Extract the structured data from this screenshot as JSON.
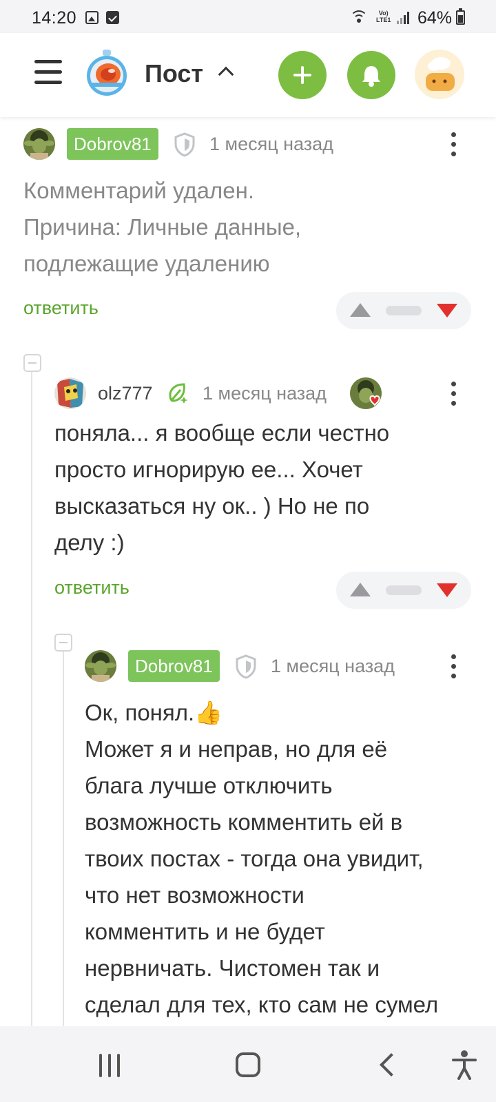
{
  "status_bar": {
    "time": "14:20",
    "network_label": "Vo)\nLTE1",
    "battery": "64%",
    "battery_level": 0.64,
    "icons": [
      "gallery-icon",
      "check-icon",
      "wifi-icon",
      "volte-icon",
      "signal-icon",
      "battery-icon"
    ]
  },
  "header": {
    "title": "Пост",
    "icons": [
      "menu-icon",
      "logo-icon",
      "chevron-up-icon",
      "plus-icon",
      "bell-icon",
      "avatar"
    ],
    "accent_color": "#7dbe42"
  },
  "comments": [
    {
      "author": "Dobrov81",
      "author_badge": true,
      "time": "1 месяц назад",
      "text_lines": [
        "Комментарий удален.",
        "Причина: Личные данные,",
        "подлежащие удалению"
      ],
      "deleted": true,
      "reply_label": "ответить"
    },
    {
      "author": "olz777",
      "author_badge": false,
      "time": "1 месяц назад",
      "text_lines": [
        "поняла... я вообще если честно",
        "просто игнорирую ее... Хочет",
        "высказаться ну ок.. ) Но не по",
        "делу :)"
      ],
      "deleted": false,
      "reply_label": "ответить"
    },
    {
      "author": "Dobrov81",
      "author_badge": true,
      "time": "1 месяц назад",
      "text_lines": [
        "Ок, понял.👍",
        "Может я и неправ, но для её",
        "блага лучше отключить",
        "возможность комментить ей в",
        "твоих постах - тогда она увидит,",
        "что нет возможности",
        "комментить и не будет",
        "нервничать. Чистомен так и",
        "сделал для тех, кто сам не сумел"
      ],
      "deleted": false
    }
  ],
  "vote_colors": {
    "up": "#9a9a9e",
    "down": "#e2312d"
  },
  "nav_bar": {
    "icons": [
      "recent-apps-icon",
      "home-icon",
      "back-icon",
      "accessibility-icon"
    ]
  }
}
